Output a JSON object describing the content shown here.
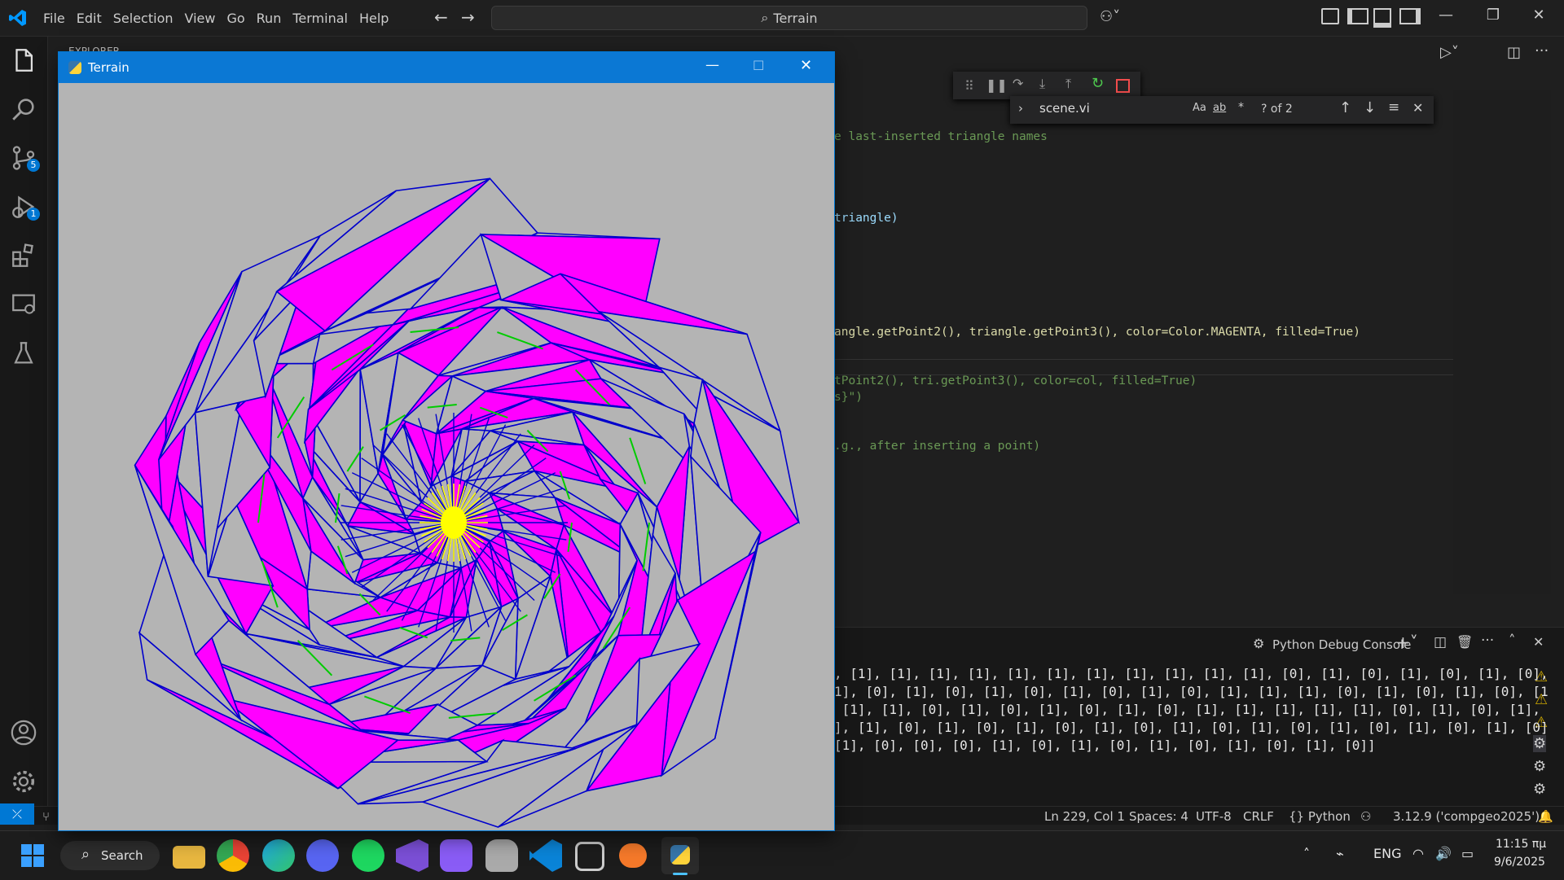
{
  "menu": [
    "File",
    "Edit",
    "Selection",
    "View",
    "Go",
    "Run",
    "Terminal",
    "Help"
  ],
  "search": {
    "text": "Terrain"
  },
  "activity_badges": {
    "source_control": "5",
    "run_debug": "1"
  },
  "explorer_label": "EXPLORER",
  "code_lines": [
    "e last-inserted triangle names",
    "triangle)",
    "angle.getPoint2(), triangle.getPoint3(), color=Color.MAGENTA, filled=True)",
    "tPoint2(), tri.getPoint3(), color=col, filled=True)",
    "s}\")",
    ".g., after inserting a point)"
  ],
  "find": {
    "value": "scene.vi",
    "result": "? of 2",
    "opts": [
      "Aa",
      "ab",
      "*"
    ]
  },
  "panel": {
    "title": "Python Debug Console",
    "output": [
      ", [1], [1], [1], [1], [1], [1], [1], [1], [1], [1], [1], [0], [1], [0], [1], [0], [1], [0],",
      "1], [0], [1], [0], [1], [0], [1], [0], [1], [0], [1], [1], [1], [0], [1], [0], [1], [0], [1",
      " [1], [1], [0], [1], [0], [1], [0], [1], [0], [1], [1], [1], [1], [1], [0], [1], [0], [1],",
      "], [1], [0], [1], [0], [1], [0], [1], [0], [1], [0], [1], [0], [1], [0], [1], [0], [1], [0]",
      "[1], [0], [0], [0], [1], [0], [1], [0], [1], [0], [1], [0], [1], [0]]"
    ]
  },
  "status": {
    "position": "Ln 229, Col 1",
    "spaces": "Spaces: 4",
    "encoding": "UTF-8",
    "eol": "CRLF",
    "language": "{} Python",
    "interpreter": "3.12.9 ('compgeo2025')"
  },
  "taskbar": {
    "search": "Search",
    "lang": "ENG",
    "time": "11:15 πμ",
    "date": "9/6/2025"
  },
  "python_window": {
    "title": "Terrain"
  },
  "colors": {
    "magenta": "#ff00ff",
    "blue": "#0000cc",
    "green": "#00cc00",
    "yellow": "#ffff00",
    "bg": "#b4b4b4"
  }
}
